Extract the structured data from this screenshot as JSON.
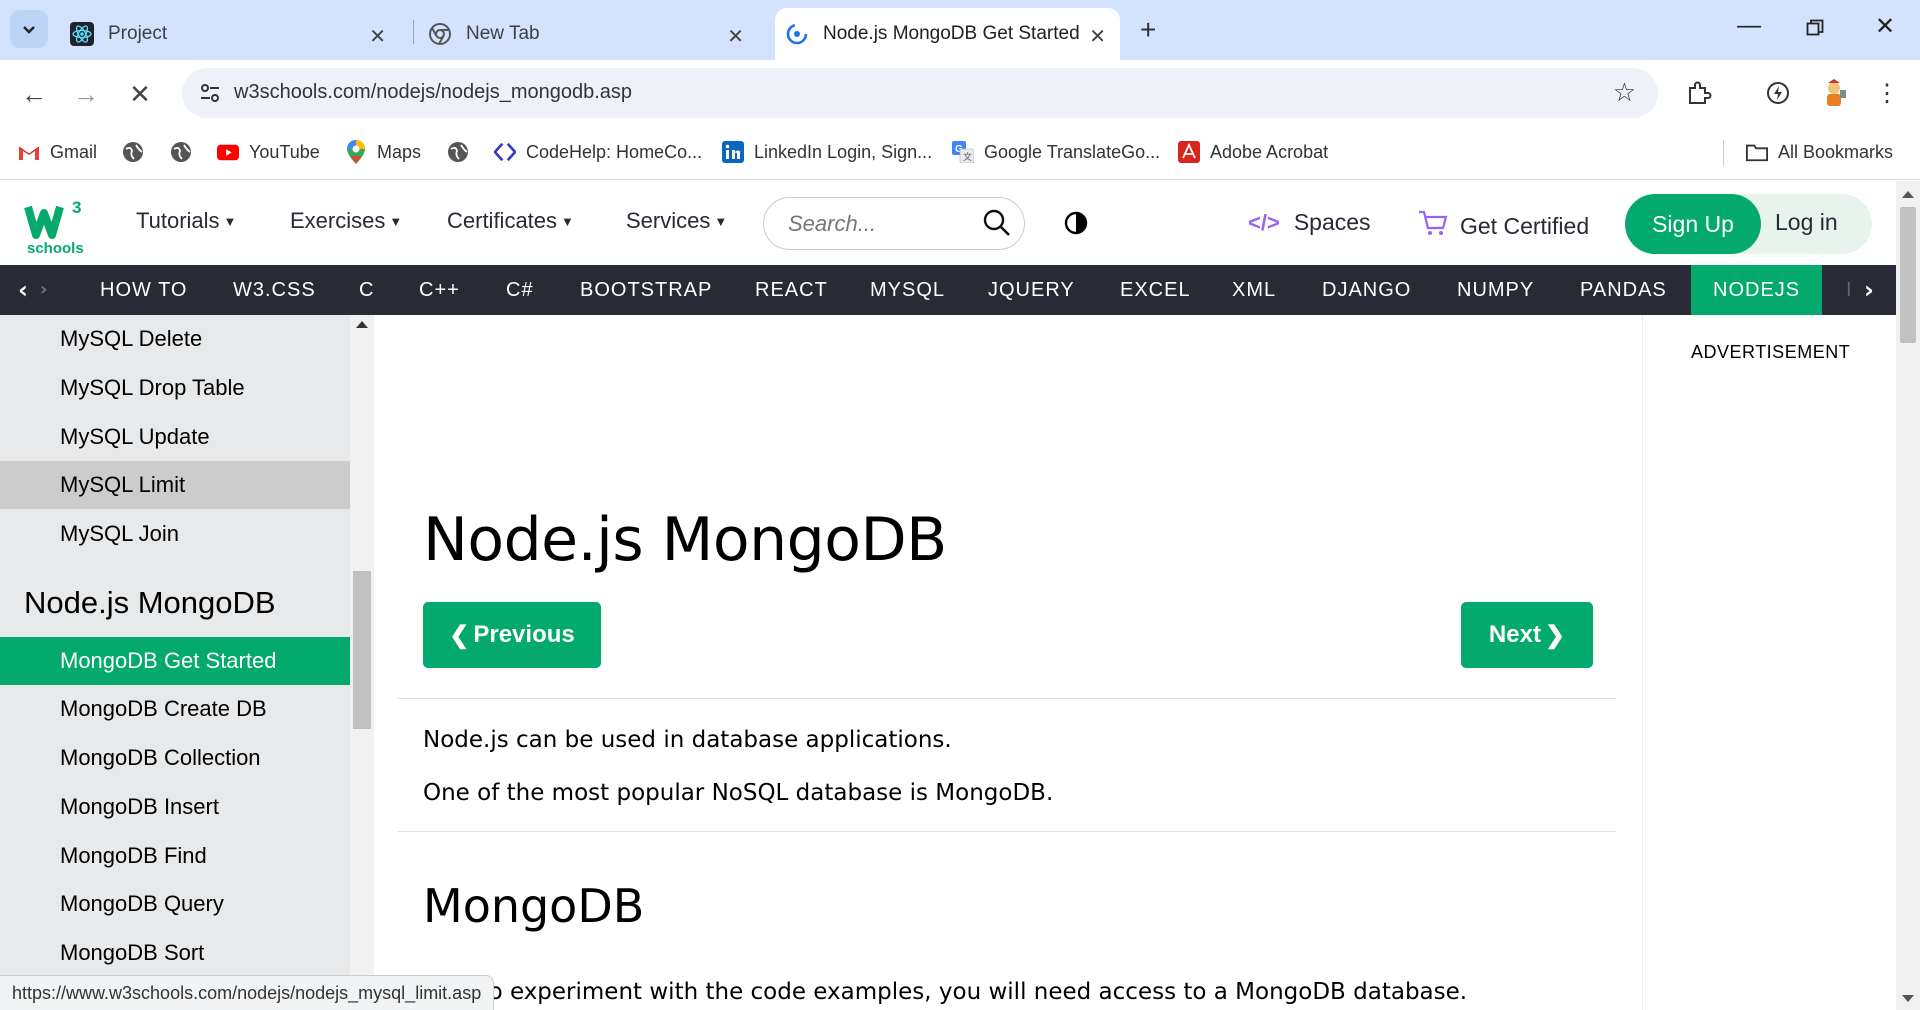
{
  "browser": {
    "tabs": [
      {
        "title": "Project",
        "icon": "react-icon"
      },
      {
        "title": "New Tab",
        "icon": "chrome-icon"
      },
      {
        "title": "Node.js MongoDB Get Started",
        "icon": "w3schools-loading-icon",
        "active": true
      }
    ],
    "url": "w3schools.com/nodejs/nodejs_mongodb.asp",
    "bookmarks": [
      {
        "label": "Gmail",
        "icon": "gmail-icon"
      },
      {
        "label": "",
        "icon": "globe-icon"
      },
      {
        "label": "",
        "icon": "globe-icon"
      },
      {
        "label": "YouTube",
        "icon": "youtube-icon"
      },
      {
        "label": "Maps",
        "icon": "maps-icon"
      },
      {
        "label": "",
        "icon": "globe-icon"
      },
      {
        "label": "CodeHelp: HomeCo...",
        "icon": "codehelp-icon"
      },
      {
        "label": "LinkedIn Login, Sign...",
        "icon": "linkedin-icon"
      },
      {
        "label": "Google TranslateGo...",
        "icon": "google-translate-icon"
      },
      {
        "label": "Adobe Acrobat",
        "icon": "acrobat-icon"
      }
    ],
    "all_bookmarks": "All Bookmarks",
    "status_url": "https://www.w3schools.com/nodejs/nodejs_mysql_limit.asp"
  },
  "site": {
    "logo_text": "schools",
    "logo_super": "3",
    "nav": [
      "Tutorials",
      "Exercises",
      "Certificates",
      "Services"
    ],
    "search_placeholder": "Search...",
    "spaces": "Spaces",
    "get_certified": "Get Certified",
    "sign_up": "Sign Up",
    "log_in": "Log in",
    "subnav": [
      "HOW TO",
      "W3.CSS",
      "C",
      "C++",
      "C#",
      "BOOTSTRAP",
      "REACT",
      "MYSQL",
      "JQUERY",
      "EXCEL",
      "XML",
      "DJANGO",
      "NUMPY",
      "PANDAS",
      "NODEJS",
      "I"
    ],
    "subnav_active": "NODEJS"
  },
  "sidebar": {
    "items_top": [
      "MySQL Delete",
      "MySQL Drop Table",
      "MySQL Update",
      "MySQL Limit",
      "MySQL Join"
    ],
    "hovered": "MySQL Limit",
    "section_heading": "Node.js MongoDB",
    "items_bottom": [
      "MongoDB Get Started",
      "MongoDB Create DB",
      "MongoDB Collection",
      "MongoDB Insert",
      "MongoDB Find",
      "MongoDB Query",
      "MongoDB Sort"
    ],
    "active": "MongoDB Get Started"
  },
  "content": {
    "title": "Node.js MongoDB",
    "prev": "Previous",
    "next": "Next",
    "para1": "Node.js can be used in database applications.",
    "para2": "One of the most popular NoSQL database is MongoDB.",
    "h2": "MongoDB",
    "para3": "able to experiment with the code examples, you will need access to a MongoDB database."
  },
  "ad": {
    "label": "ADVERTISEMENT"
  },
  "colors": {
    "brand_green": "#04aa6d",
    "dark_nav": "#282a35",
    "sidebar_bg": "#e7e9eb",
    "tabbar": "#d3e3fd"
  }
}
